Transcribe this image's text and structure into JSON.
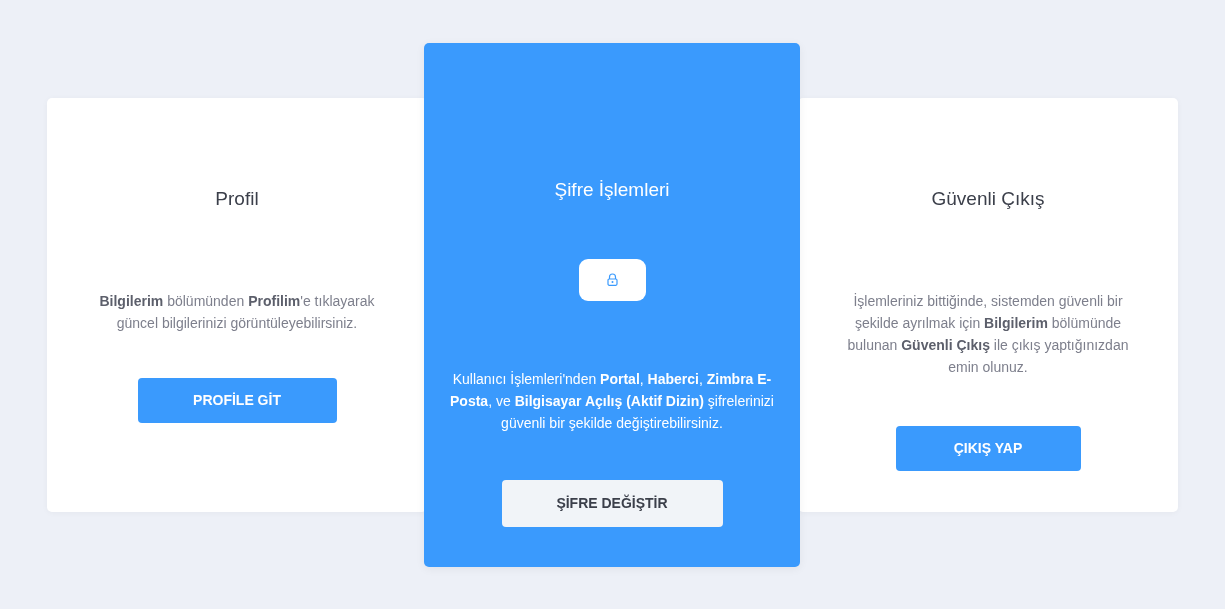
{
  "cards": [
    {
      "kind": "plain",
      "title": "Profil",
      "text": "**Bilgilerim** bölümünden **Profilim**'e tıklayarak güncel bilgilerinizi görüntüleyebilirsiniz.",
      "button": "PROFİLE GİT"
    },
    {
      "kind": "highlight",
      "title": "Şifre İşlemleri",
      "text": "Kullanıcı İşlemleri'nden **Portal**, **Haberci**, **Zimbra E-Posta**, ve **Bilgisayar Açılış (Aktif Dizin)** şifrelerinizi güvenli bir şekilde değiştirebilirsiniz.",
      "button": "ŞİFRE DEĞİŞTİR"
    },
    {
      "kind": "plain",
      "title": "Güvenli Çıkış",
      "text": "İşlemleriniz bittiğinde, sistemden güvenli bir şekilde ayrılmak için **Bilgilerim** bölümünde bulunan **Güvenli Çıkış** ile çıkış yaptığınızdan emin olunuz.",
      "button": "ÇIKIŞ YAP"
    }
  ]
}
